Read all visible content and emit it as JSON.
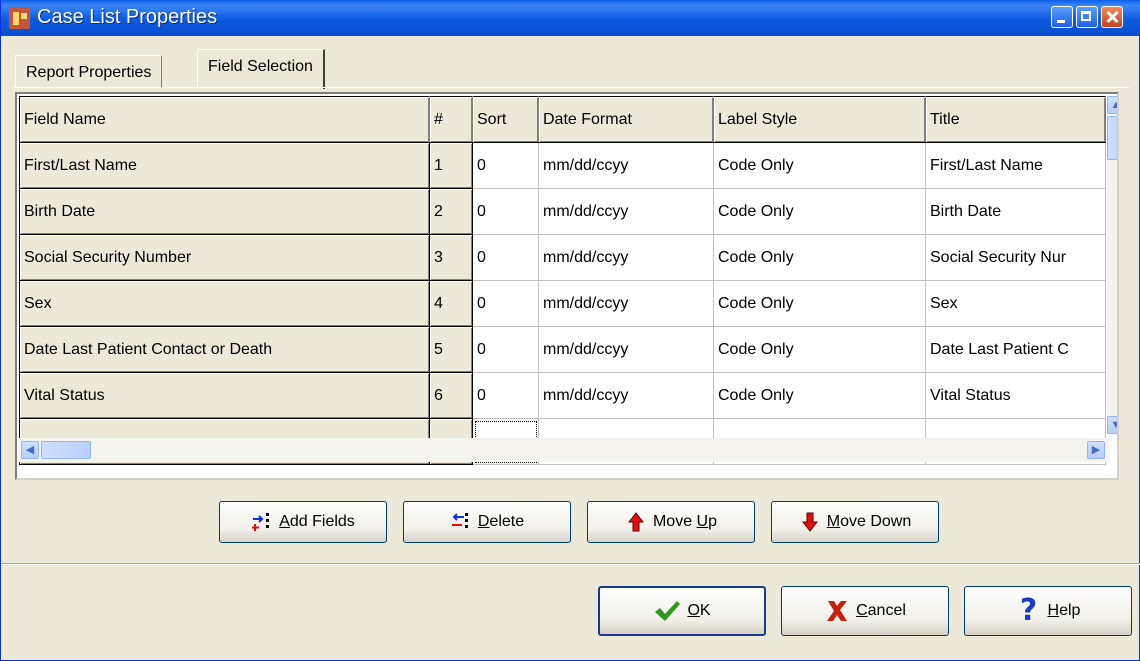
{
  "window": {
    "title": "Case List Properties"
  },
  "tabs": [
    {
      "label": "Report Properties",
      "active": false
    },
    {
      "label": "Field Selection",
      "active": true
    }
  ],
  "grid": {
    "columns": [
      "Field Name",
      "#",
      "Sort",
      "Date Format",
      "Label Style",
      "Title"
    ],
    "rows": [
      {
        "field": "First/Last Name",
        "num": "1",
        "sort": "0",
        "date_format": "mm/dd/ccyy",
        "label_style": "Code Only",
        "title": "First/Last Name"
      },
      {
        "field": "Birth Date",
        "num": "2",
        "sort": "0",
        "date_format": "mm/dd/ccyy",
        "label_style": "Code Only",
        "title": "Birth Date"
      },
      {
        "field": "Social Security Number",
        "num": "3",
        "sort": "0",
        "date_format": "mm/dd/ccyy",
        "label_style": "Code Only",
        "title": "Social Security Nur"
      },
      {
        "field": "Sex",
        "num": "4",
        "sort": "0",
        "date_format": "mm/dd/ccyy",
        "label_style": "Code Only",
        "title": "Sex"
      },
      {
        "field": "Date Last Patient Contact or Death",
        "num": "5",
        "sort": "0",
        "date_format": "mm/dd/ccyy",
        "label_style": "Code Only",
        "title": "Date Last Patient C"
      },
      {
        "field": "Vital Status",
        "num": "6",
        "sort": "0",
        "date_format": "mm/dd/ccyy",
        "label_style": "Code Only",
        "title": "Vital Status"
      }
    ]
  },
  "actions": {
    "add_mnemonic": "A",
    "add_rest": "dd Fields",
    "delete_mnemonic": "D",
    "delete_rest": "elete",
    "moveup_prefix": "Move ",
    "moveup_mnemonic": "U",
    "moveup_rest": "p",
    "movedown_mnemonic": "M",
    "movedown_rest": "ove Down"
  },
  "dialog_buttons": {
    "ok_mnemonic": "O",
    "ok_rest": "K",
    "cancel_mnemonic": "C",
    "cancel_rest": "ancel",
    "help_mnemonic": "H",
    "help_rest": "elp"
  },
  "colors": {
    "titlebar": "#0a5fe8",
    "face": "#ece9d8",
    "ok_check": "#2f9a1a",
    "cancel_x": "#c81e0e",
    "help_q": "#1f3cc8",
    "arrow_red": "#e01010",
    "arrow_blue": "#1030e0"
  }
}
